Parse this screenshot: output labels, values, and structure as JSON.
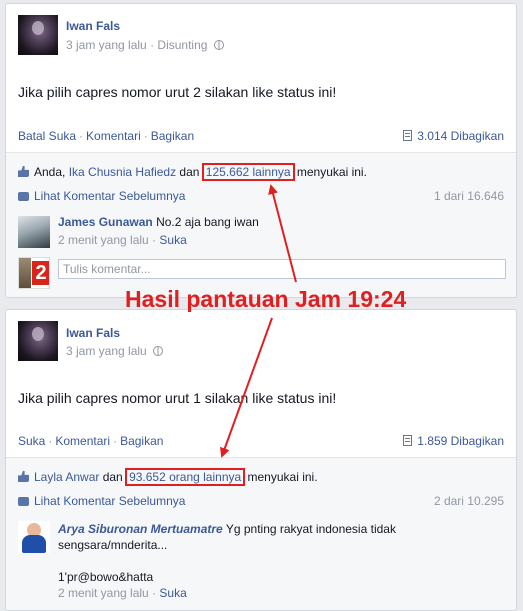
{
  "post1": {
    "author": "Iwan Fals",
    "time": "3 jam yang lalu",
    "edited": "Disunting",
    "status": "Jika pilih capres nomor urut 2 silakan like status ini!",
    "actions": [
      "Batal Suka",
      "Komentari",
      "Bagikan"
    ],
    "shares": "3.014 Dibagikan",
    "likes_prefix": "Anda, ",
    "likes_names": "Ika Chusnia Hafiedz",
    "likes_mid": " dan ",
    "likes_highlight": "125.662 lainnya",
    "likes_suffix": " menyukai ini.",
    "view_prev": "Lihat Komentar Sebelumnya",
    "counter": "1 dari 16.646",
    "comment": {
      "name": "James Gunawan",
      "text": "No.2 aja bang iwan",
      "time": "2 menit yang lalu",
      "like": "Suka"
    },
    "input_placeholder": "Tulis komentar..."
  },
  "post2": {
    "author": "Iwan Fals",
    "time": "3 jam yang lalu",
    "status": "Jika pilih capres nomor urut 1 silakan like status ini!",
    "actions": [
      "Suka",
      "Komentari",
      "Bagikan"
    ],
    "shares": "1.859 Dibagikan",
    "likes_names": "Layla Anwar",
    "likes_mid": " dan ",
    "likes_highlight": "93.652 orang lainnya",
    "likes_suffix": " menyukai ini.",
    "view_prev": "Lihat Komentar Sebelumnya",
    "counter": "2 dari 10.295",
    "comment": {
      "name": "Arya Siburonan Mertuamatre",
      "text_line1": "Yg pnting rakyat indonesia tidak",
      "text_line2": "sengsara/mnderita...",
      "text_line3": "1'pr@bowo&hatta",
      "time": "2 menit yang lalu",
      "like": "Suka"
    }
  },
  "annotation": {
    "text": "Hasil pantauan Jam 19:24",
    "color": "#e02020"
  },
  "colors": {
    "link": "#3b5998",
    "meta": "#9197a3",
    "feedback_bg": "#f6f7f9"
  },
  "icons": [
    "globe-icon",
    "share-icon",
    "like-icon",
    "comment-icon"
  ]
}
